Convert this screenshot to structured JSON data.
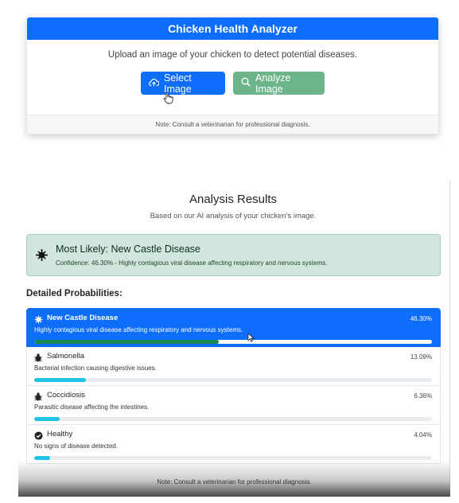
{
  "analyzer": {
    "title": "Chicken Health Analyzer",
    "description": "Upload an image of your chicken to detect potential diseases.",
    "select_button": "Select Image",
    "analyze_button": "Analyze Image",
    "note": "Note: Consult a veterinarian for professional diagnosis."
  },
  "results": {
    "title": "Analysis Results",
    "subtitle": "Based on our AI analysis of your chicken's image.",
    "likely_title": "Most Likely: New Castle Disease",
    "likely_confidence": "Confidence: 46.30% - Highly contagious viral disease affecting respiratory and nervous systems.",
    "detailed_heading": "Detailed Probabilities:",
    "items": [
      {
        "name": "New Castle Disease",
        "percent": "46.30%",
        "fraction": 0.463,
        "description": "Highly contagious viral disease affecting respiratory and nervous systems.",
        "icon": "virus-icon"
      },
      {
        "name": "Salmonella",
        "percent": "13.09%",
        "fraction": 0.1309,
        "description": "Bacterial infection causing digestive issues.",
        "icon": "bug-icon"
      },
      {
        "name": "Coccidiosis",
        "percent": "6.36%",
        "fraction": 0.0636,
        "description": "Parasitic disease affecting the intestines.",
        "icon": "bug-icon"
      },
      {
        "name": "Healthy",
        "percent": "4.04%",
        "fraction": 0.0404,
        "description": "No signs of disease detected.",
        "icon": "check-circle-icon"
      }
    ],
    "note": "Note: Consult a veterinarian for professional diagnosis."
  },
  "colors": {
    "primary": "#0d6efd",
    "success": "#6cb58b",
    "alert_bg": "#d1e7dd",
    "bar_info": "#1fc3e6",
    "bar_success": "#198754"
  }
}
